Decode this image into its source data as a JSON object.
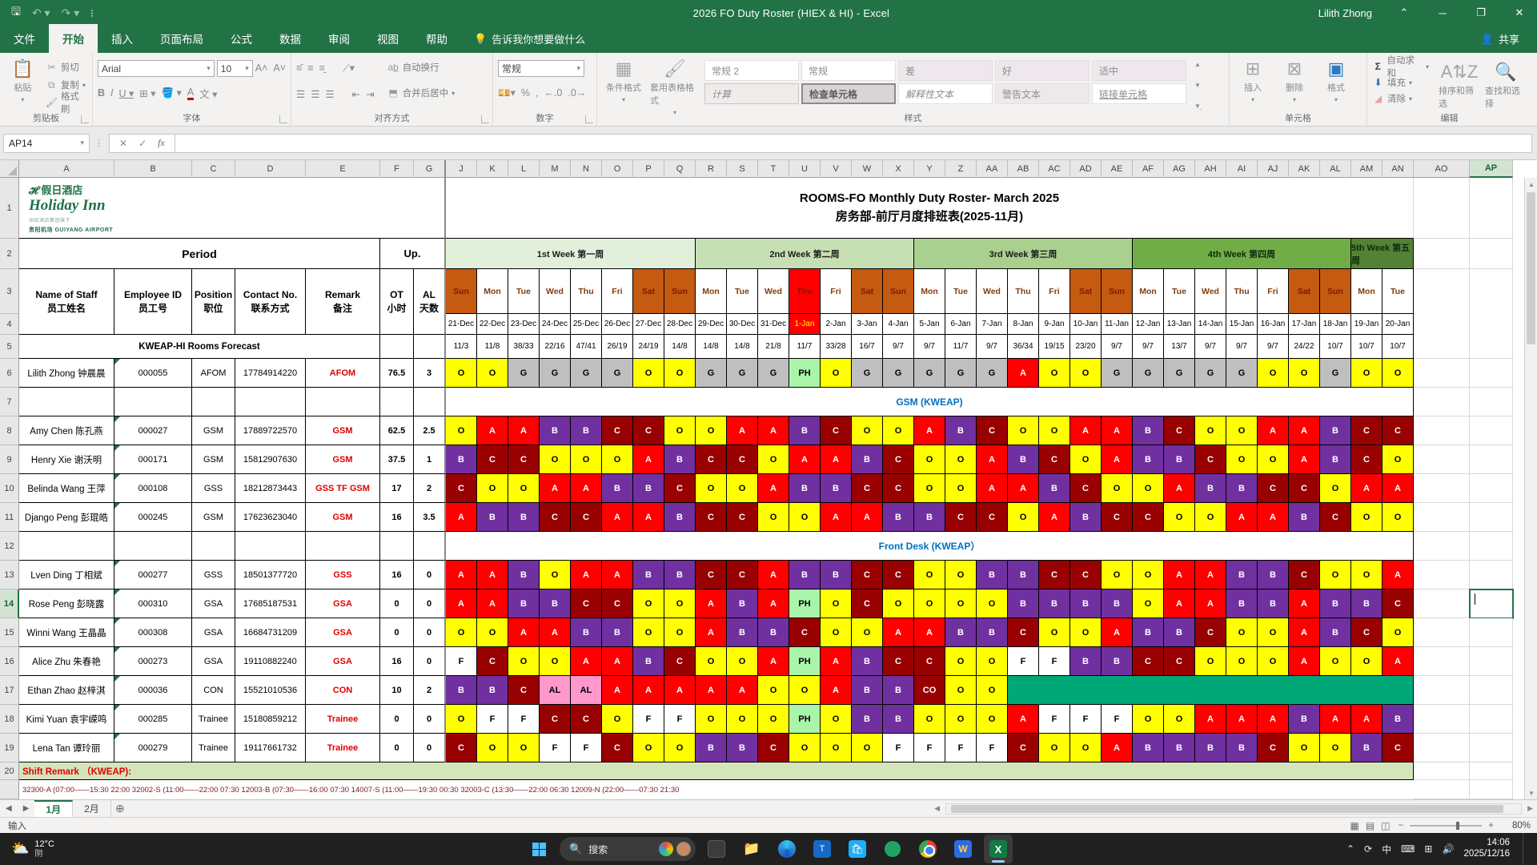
{
  "title_bar": {
    "title": "2026 FO Duty Roster (HIEX & HI)  -  Excel",
    "user": "Lilith Zhong"
  },
  "ribbon": {
    "tabs": [
      "文件",
      "开始",
      "插入",
      "页面布局",
      "公式",
      "数据",
      "审阅",
      "视图",
      "帮助"
    ],
    "active_tab": "开始",
    "tellme": "告诉我你想要做什么",
    "share": "共享",
    "clipboard": {
      "paste": "粘贴",
      "cut": "剪切",
      "copy": "复制",
      "painter": "格式刷",
      "label": "剪贴板"
    },
    "font": {
      "name": "Arial",
      "size": "10",
      "label": "字体"
    },
    "alignment": {
      "wrap": "自动换行",
      "merge": "合并后居中",
      "label": "对齐方式"
    },
    "number": {
      "format": "常规",
      "label": "数字"
    },
    "styles": {
      "conditional": "条件格式",
      "table": "套用表格格式",
      "label": "样式",
      "gallery_row1": [
        "常规 2",
        "常规",
        "差",
        "好",
        "适中"
      ],
      "gallery_row2": [
        "计算",
        "检查单元格",
        "解释性文本",
        "警告文本",
        "链接单元格"
      ],
      "selected": "检查单元格"
    },
    "cells": {
      "insert": "插入",
      "delete": "删除",
      "format": "格式",
      "label": "单元格"
    },
    "editing": {
      "autosum": "自动求和",
      "fill": "填充",
      "clear": "清除",
      "sort": "排序和筛选",
      "find": "查找和选择",
      "label": "编辑"
    }
  },
  "formula_bar": {
    "name_box": "AP14"
  },
  "sheet": {
    "active_cell": "AP14",
    "title_en": "ROOMS-FO Monthly Duty Roster- March 2025",
    "title_cn": "房务部-前厅月度排班表(2025-11月)",
    "logo": {
      "cn": "假日酒店",
      "en": "Holiday Inn",
      "sub": "洲际酒店集团旗下",
      "airport": "贵阳机场 GUIYANG AIRPORT"
    },
    "period_label": "Period",
    "up_label": "Up.",
    "headers": {
      "name": [
        "Name of Staff",
        "员工姓名"
      ],
      "id": [
        "Employee ID",
        "员工号"
      ],
      "position": [
        "Position",
        "职位"
      ],
      "contact": [
        "Contact No.",
        "联系方式"
      ],
      "remark": [
        "Remark",
        "备注"
      ],
      "ot": [
        "OT",
        "小时"
      ],
      "al": [
        "AL",
        "天数"
      ]
    },
    "forecast_label": "KWEAP-HI Rooms Forecast",
    "left_letters": [
      "A",
      "B",
      "C",
      "D",
      "E",
      "F",
      "G"
    ],
    "day_letters": [
      "J",
      "K",
      "L",
      "M",
      "N",
      "O",
      "P",
      "Q",
      "R",
      "S",
      "T",
      "U",
      "V",
      "W",
      "X",
      "Y",
      "Z",
      "AA",
      "AB",
      "AC",
      "AD",
      "AE",
      "AF",
      "AG",
      "AH",
      "AI",
      "AJ",
      "AK",
      "AL",
      "AM",
      "AN"
    ],
    "right_letters": [
      "AO",
      "AP"
    ],
    "weeks": [
      {
        "label": "1st Week 第一周",
        "span": 8,
        "bg": "#E2EFDA"
      },
      {
        "label": "2nd Week 第二周",
        "span": 7,
        "bg": "#C6E0B4"
      },
      {
        "label": "3rd Week 第三周",
        "span": 7,
        "bg": "#A9D08E"
      },
      {
        "label": "4th Week 第四周",
        "span": 7,
        "bg": "#70AD47"
      },
      {
        "label": "5th Week 第五周",
        "span": 2,
        "bg": "#548235"
      }
    ],
    "day_names": [
      "Sun",
      "Mon",
      "Tue",
      "Wed",
      "Thu",
      "Fri",
      "Sat",
      "Sun",
      "Mon",
      "Tue",
      "Wed",
      "Thu",
      "Fri",
      "Sat",
      "Sun",
      "Mon",
      "Tue",
      "Wed",
      "Thu",
      "Fri",
      "Sat",
      "Sun",
      "Mon",
      "Tue",
      "Wed",
      "Thu",
      "Fri",
      "Sat",
      "Sun",
      "Mon",
      "Tue"
    ],
    "dates": [
      "21-Dec",
      "22-Dec",
      "23-Dec",
      "24-Dec",
      "25-Dec",
      "26-Dec",
      "27-Dec",
      "28-Dec",
      "29-Dec",
      "30-Dec",
      "31-Dec",
      "1-Jan",
      "2-Jan",
      "3-Jan",
      "4-Jan",
      "5-Jan",
      "6-Jan",
      "7-Jan",
      "8-Jan",
      "9-Jan",
      "10-Jan",
      "11-Jan",
      "12-Jan",
      "13-Jan",
      "14-Jan",
      "15-Jan",
      "16-Jan",
      "17-Jan",
      "18-Jan",
      "19-Jan",
      "20-Jan"
    ],
    "weekend_cols": [
      1,
      7,
      8,
      14,
      15,
      21,
      22,
      28,
      29
    ],
    "holiday_col": 12,
    "forecast": [
      "11/3",
      "11/8",
      "38/33",
      "22/16",
      "47/41",
      "26/19",
      "24/19",
      "14/8",
      "14/8",
      "14/8",
      "21/8",
      "11/7",
      "33/28",
      "16/7",
      "9/7",
      "9/7",
      "11/7",
      "9/7",
      "36/34",
      "19/15",
      "23/20",
      "9/7",
      "9/7",
      "13/7",
      "9/7",
      "9/7",
      "9/7",
      "24/22",
      "10/7",
      "10/7",
      "10/7"
    ],
    "sections": [
      {
        "row": 7,
        "label": "GSM (KWEAP)"
      },
      {
        "row": 12,
        "label": "Front Desk (KWEAP）"
      }
    ],
    "staff": [
      {
        "row": 6,
        "name": "Lilith Zhong 钟晨晨",
        "id": "000055",
        "position": "AFOM",
        "contact": "17784914220",
        "remark": "AFOM",
        "ot": "76.5",
        "al": "3",
        "shifts": [
          "O",
          "O",
          "G",
          "G",
          "G",
          "G",
          "O",
          "O",
          "G",
          "G",
          "G",
          "PH",
          "O",
          "G",
          "G",
          "G",
          "G",
          "G",
          "A",
          "O",
          "O",
          "G",
          "G",
          "G",
          "G",
          "G",
          "O",
          "O",
          "G",
          "O",
          "O"
        ]
      },
      {
        "row": 8,
        "name": "Amy Chen 陈孔燕",
        "id": "000027",
        "position": "GSM",
        "contact": "17889722570",
        "remark": "GSM",
        "ot": "62.5",
        "al": "2.5",
        "shifts": [
          "O",
          "A",
          "A",
          "B",
          "B",
          "C",
          "C",
          "O",
          "O",
          "A",
          "A",
          "B",
          "C",
          "O",
          "O",
          "A",
          "B",
          "C",
          "O",
          "O",
          "A",
          "A",
          "B",
          "C",
          "O",
          "O",
          "A",
          "A",
          "B",
          "C",
          "C"
        ]
      },
      {
        "row": 9,
        "name": "Henry Xie 谢沃明",
        "id": "000171",
        "position": "GSM",
        "contact": "15812907630",
        "remark": "GSM",
        "ot": "37.5",
        "al": "1",
        "shifts": [
          "B",
          "C",
          "C",
          "O",
          "O",
          "O",
          "A",
          "B",
          "C",
          "C",
          "O",
          "A",
          "A",
          "B",
          "C",
          "O",
          "O",
          "A",
          "B",
          "C",
          "O",
          "A",
          "B",
          "B",
          "C",
          "O",
          "O",
          "A",
          "B",
          "C",
          "O"
        ]
      },
      {
        "row": 10,
        "name": "Belinda Wang 王萍",
        "id": "000108",
        "position": "GSS",
        "contact": "18212873443",
        "remark": "GSS TF GSM",
        "ot": "17",
        "al": "2",
        "shifts": [
          "C",
          "O",
          "O",
          "A",
          "A",
          "B",
          "B",
          "C",
          "O",
          "O",
          "A",
          "B",
          "B",
          "C",
          "C",
          "O",
          "O",
          "A",
          "A",
          "B",
          "C",
          "O",
          "O",
          "A",
          "B",
          "B",
          "C",
          "C",
          "O",
          "A",
          "A"
        ]
      },
      {
        "row": 11,
        "name": "Django Peng 彭琨皓",
        "id": "000245",
        "position": "GSM",
        "contact": "17623623040",
        "remark": "GSM",
        "ot": "16",
        "al": "3.5",
        "shifts": [
          "A",
          "B",
          "B",
          "C",
          "C",
          "A",
          "A",
          "B",
          "C",
          "C",
          "O",
          "O",
          "A",
          "A",
          "B",
          "B",
          "C",
          "C",
          "O",
          "A",
          "B",
          "C",
          "C",
          "O",
          "O",
          "A",
          "A",
          "B",
          "C",
          "O",
          "O"
        ]
      },
      {
        "row": 13,
        "name": "Lven Ding 丁相斌",
        "id": "000277",
        "position": "GSS",
        "contact": "18501377720",
        "remark": "GSS",
        "ot": "16",
        "al": "0",
        "shifts": [
          "A",
          "A",
          "B",
          "O",
          "A",
          "A",
          "B",
          "B",
          "C",
          "C",
          "A",
          "B",
          "B",
          "C",
          "C",
          "O",
          "O",
          "B",
          "B",
          "C",
          "C",
          "O",
          "O",
          "A",
          "A",
          "B",
          "B",
          "C",
          "O",
          "O",
          "A"
        ]
      },
      {
        "row": 14,
        "name": "Rose Peng 彭晓露",
        "id": "000310",
        "position": "GSA",
        "contact": "17685187531",
        "remark": "GSA",
        "ot": "0",
        "al": "0",
        "shifts": [
          "A",
          "A",
          "B",
          "B",
          "C",
          "C",
          "O",
          "O",
          "A",
          "B",
          "A",
          "PH",
          "O",
          "C",
          "O",
          "O",
          "O",
          "O",
          "B",
          "B",
          "B",
          "B",
          "O",
          "A",
          "A",
          "B",
          "B",
          "A",
          "B",
          "B",
          "C"
        ]
      },
      {
        "row": 15,
        "name": "Winni Wang 王晶晶",
        "id": "000308",
        "position": "GSA",
        "contact": "16684731209",
        "remark": "GSA",
        "ot": "0",
        "al": "0",
        "shifts": [
          "O",
          "O",
          "A",
          "A",
          "B",
          "B",
          "O",
          "O",
          "A",
          "B",
          "B",
          "C",
          "O",
          "O",
          "A",
          "A",
          "B",
          "B",
          "C",
          "O",
          "O",
          "A",
          "B",
          "B",
          "C",
          "O",
          "O",
          "A",
          "B",
          "C",
          "O"
        ]
      },
      {
        "row": 16,
        "name": "Alice Zhu 朱春艳",
        "id": "000273",
        "position": "GSA",
        "contact": "19110882240",
        "remark": "GSA",
        "ot": "16",
        "al": "0",
        "shifts": [
          "F",
          "C",
          "O",
          "O",
          "A",
          "A",
          "B",
          "C",
          "O",
          "O",
          "A",
          "PH",
          "A",
          "B",
          "C",
          "C",
          "O",
          "O",
          "F",
          "F",
          "B",
          "B",
          "C",
          "C",
          "O",
          "O",
          "O",
          "A",
          "O",
          "O",
          "A"
        ]
      },
      {
        "row": 17,
        "name": "Ethan Zhao 赵梓淇",
        "id": "000036",
        "position": "CON",
        "contact": "15521010536",
        "remark": "CON",
        "ot": "10",
        "al": "2",
        "shifts": [
          "B",
          "B",
          "C",
          "AL",
          "AL",
          "A",
          "A",
          "A",
          "A",
          "A",
          "O",
          "O",
          "A",
          "B",
          "B",
          "CO",
          "O",
          "O",
          "~13"
        ]
      },
      {
        "row": 18,
        "name": "Kimi Yuan 袁宇嵘鸣",
        "id": "000285",
        "position": "Trainee",
        "contact": "15180859212",
        "remark": "Trainee",
        "ot": "0",
        "al": "0",
        "shifts": [
          "O",
          "F",
          "F",
          "C",
          "C",
          "O",
          "F",
          "F",
          "O",
          "O",
          "O",
          "PH",
          "O",
          "B",
          "B",
          "O",
          "O",
          "O",
          "A",
          "F",
          "F",
          "F",
          "O",
          "O",
          "A",
          "A",
          "A",
          "B",
          "A",
          "A",
          "B"
        ]
      },
      {
        "row": 19,
        "name": "Lena Tan 谭玲丽",
        "id": "000279",
        "position": "Trainee",
        "contact": "19117661732",
        "remark": "Trainee",
        "ot": "0",
        "al": "0",
        "shifts": [
          "C",
          "O",
          "O",
          "F",
          "F",
          "C",
          "O",
          "O",
          "B",
          "B",
          "C",
          "O",
          "O",
          "O",
          "F",
          "F",
          "F",
          "F",
          "C",
          "O",
          "O",
          "A",
          "B",
          "B",
          "B",
          "B",
          "C",
          "O",
          "O",
          "B",
          "C"
        ]
      }
    ],
    "shift_colors": {
      "O": [
        "#FFFF00",
        "#000000"
      ],
      "A": [
        "#FF0000",
        "#FFFFFF"
      ],
      "B": [
        "#7030A0",
        "#FFFFFF"
      ],
      "C": [
        "#990000",
        "#FFFFFF"
      ],
      "G": [
        "#BFBFBF",
        "#000000"
      ],
      "F": [
        "#FFFFFF",
        "#000000"
      ],
      "PH": [
        "#A9F5A9",
        "#000000"
      ],
      "AL": [
        "#FF99CC",
        "#000000"
      ],
      "CO": [
        "#990000",
        "#FFFFFF"
      ],
      "~": [
        "#00A878",
        "#FFFFFF"
      ]
    },
    "remark_band": "Shift Remark （KWEAP):",
    "remark_detail": "32300-A (07:00——15:30    22:00    32002-S (11:00——22:00    07:30    12003-B (07:30——16:00    07:30    14007-S (11:00——19:30    00:30    32003-C (13:30——22:00    06:30    12009-N (22:00——07:30    21:30"
  },
  "tabs_bar": {
    "sheets": [
      "1月",
      "2月"
    ],
    "active": "1月"
  },
  "status_bar": {
    "mode": "输入",
    "zoom": "80%"
  },
  "taskbar": {
    "weather_temp": "12°C",
    "weather_cond": "阴",
    "search_placeholder": "搜索",
    "ime": "中",
    "time": "14:06",
    "date": "2025/12/16"
  }
}
